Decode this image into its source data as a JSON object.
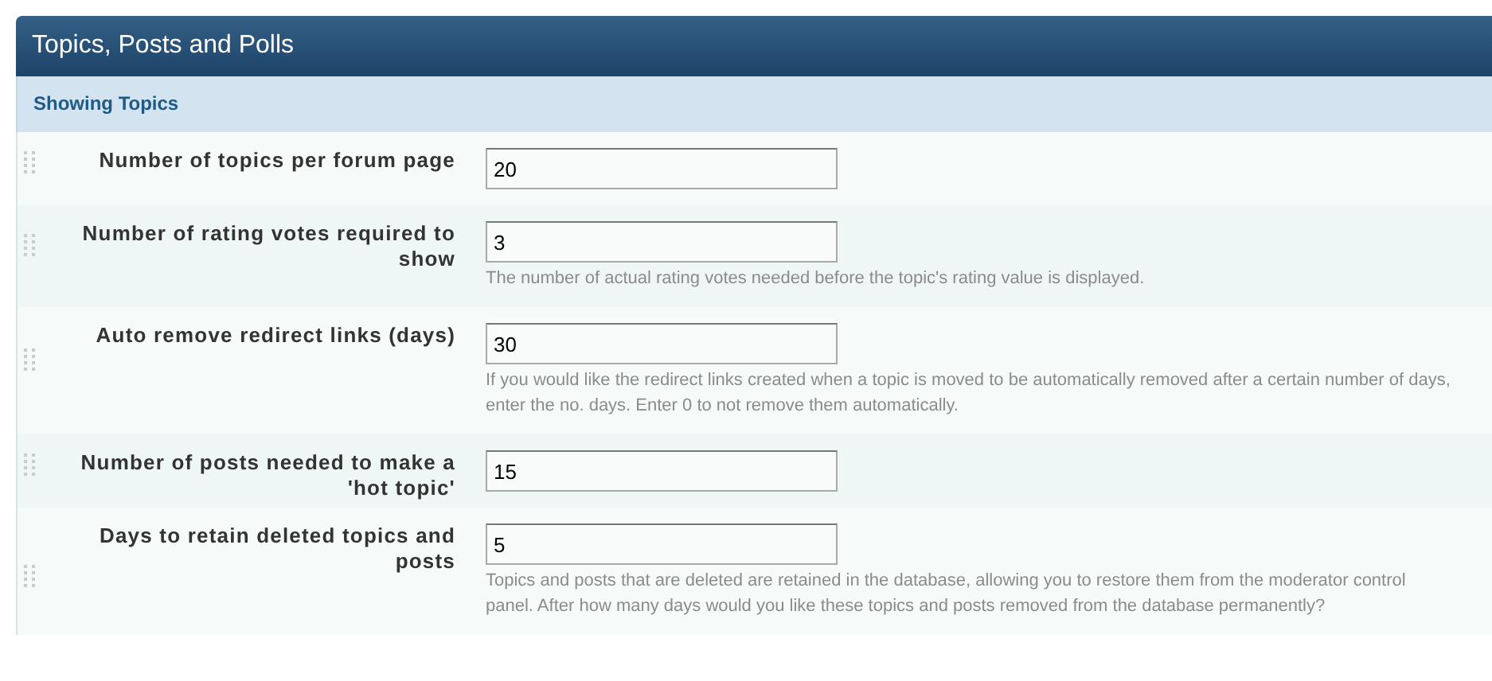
{
  "panel": {
    "title": "Topics, Posts and Polls"
  },
  "section": {
    "title": "Showing Topics"
  },
  "settings": [
    {
      "label": "Number of topics per forum page",
      "value": "20"
    },
    {
      "label": "Number of rating votes required to show",
      "value": "3",
      "description": "The number of actual rating votes needed before the topic's rating value is displayed."
    },
    {
      "label": "Auto remove redirect links (days)",
      "value": "30",
      "description": "If you would like the redirect links created when a topic is moved to be automatically removed after a certain number of days, enter the no. days. Enter 0 to not remove them automatically."
    },
    {
      "label": "Number of posts needed to make a 'hot topic'",
      "value": "15"
    },
    {
      "label": "Days to retain deleted topics and posts",
      "value": "5",
      "description": "Topics and posts that are deleted are retained in the database, allowing you to restore them from the moderator control panel. After how many days would you like these topics and posts removed from the database permanently?"
    }
  ]
}
